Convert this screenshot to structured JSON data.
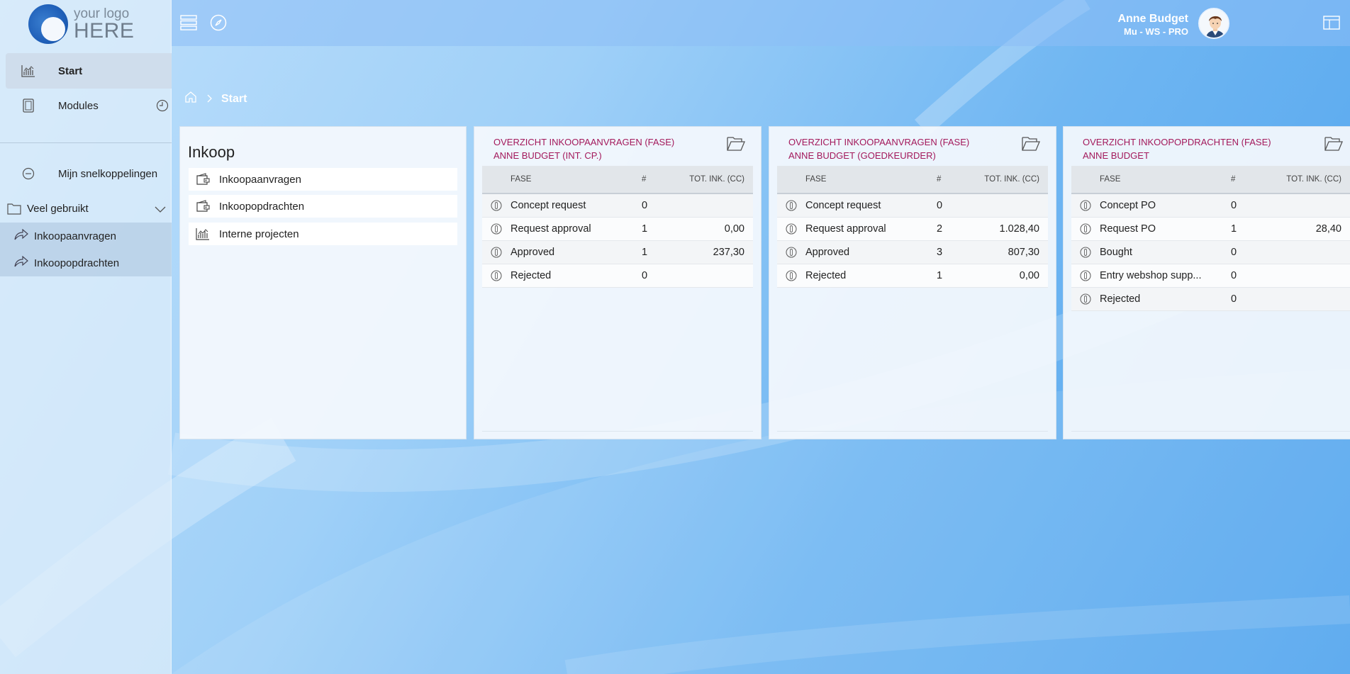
{
  "logo": {
    "line1": "your logo",
    "line2": "HERE"
  },
  "sidebar": {
    "items": [
      {
        "label": "Start",
        "icon": "chart-icon"
      },
      {
        "label": "Modules",
        "icon": "modules-icon"
      }
    ],
    "shortcuts_label": "Mijn snelkoppelingen",
    "group": {
      "label": "Veel gebruikt",
      "items": [
        {
          "label": "Inkoopaanvragen"
        },
        {
          "label": "Inkoopopdrachten"
        }
      ]
    }
  },
  "topbar": {
    "user_name": "Anne Budget",
    "user_role": "Mu - WS - PRO"
  },
  "breadcrumb": {
    "current": "Start"
  },
  "inkoop_card": {
    "title": "Inkoop",
    "items": [
      {
        "label": "Inkoopaanvragen",
        "icon": "wallet-icon"
      },
      {
        "label": "Inkoopopdrachten",
        "icon": "wallet-icon"
      },
      {
        "label": "Interne projecten",
        "icon": "chart-icon"
      }
    ]
  },
  "widgets": [
    {
      "title_line1": "OVERZICHT INKOOPAANVRAGEN (FASE)",
      "title_line2": "ANNE BUDGET (INT. CP.)",
      "headers": {
        "fase": "FASE",
        "count": "#",
        "total": "TOT. INK. (CC)"
      },
      "rows": [
        {
          "fase": "Concept request",
          "count": "0",
          "total": ""
        },
        {
          "fase": "Request approval",
          "count": "1",
          "total": "0,00"
        },
        {
          "fase": "Approved",
          "count": "1",
          "total": "237,30"
        },
        {
          "fase": "Rejected",
          "count": "0",
          "total": ""
        }
      ]
    },
    {
      "title_line1": "OVERZICHT INKOOPAANVRAGEN (FASE)",
      "title_line2": "ANNE BUDGET (GOEDKEURDER)",
      "headers": {
        "fase": "FASE",
        "count": "#",
        "total": "TOT. INK. (CC)"
      },
      "rows": [
        {
          "fase": "Concept request",
          "count": "0",
          "total": ""
        },
        {
          "fase": "Request approval",
          "count": "2",
          "total": "1.028,40"
        },
        {
          "fase": "Approved",
          "count": "3",
          "total": "807,30"
        },
        {
          "fase": "Rejected",
          "count": "1",
          "total": "0,00"
        }
      ]
    },
    {
      "title_line1": "OVERZICHT INKOOPOPDRACHTEN (FASE)",
      "title_line2": "ANNE BUDGET",
      "headers": {
        "fase": "FASE",
        "count": "#",
        "total": "TOT. INK. (CC)"
      },
      "rows": [
        {
          "fase": "Concept PO",
          "count": "0",
          "total": ""
        },
        {
          "fase": "Request PO",
          "count": "1",
          "total": "28,40"
        },
        {
          "fase": "Bought",
          "count": "0",
          "total": ""
        },
        {
          "fase": "Entry webshop supp...",
          "count": "0",
          "total": ""
        },
        {
          "fase": "Rejected",
          "count": "0",
          "total": ""
        }
      ]
    }
  ],
  "colors": {
    "accent": "#a3195b",
    "background": "#6fb6f2"
  }
}
